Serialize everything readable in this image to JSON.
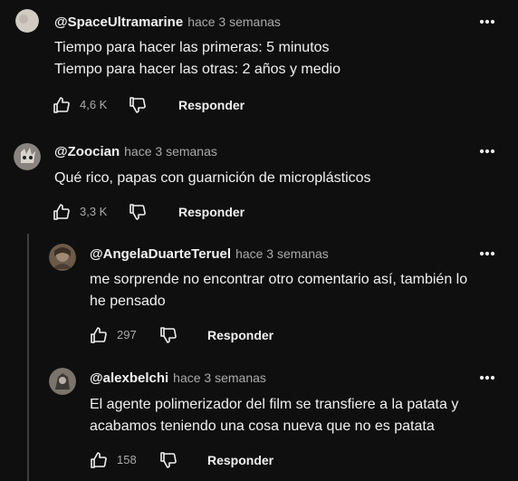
{
  "comments": [
    {
      "author": "@SpaceUltramarine",
      "timestamp": "hace 3 semanas",
      "lines": [
        "Tiempo para hacer las primeras: 5 minutos",
        "Tiempo para hacer las otras: 2 años y medio"
      ],
      "likes": "4,6 K",
      "reply_label": "Responder",
      "avatar_color": "#d0cbc3"
    },
    {
      "author": "@Zoocian",
      "timestamp": "hace 3 semanas",
      "lines": [
        "Qué rico, papas con guarnición de microplásticos"
      ],
      "likes": "3,3 K",
      "reply_label": "Responder",
      "avatar_color": "#8a8480"
    }
  ],
  "replies": [
    {
      "author": "@AngelaDuarteTeruel",
      "timestamp": "hace 3 semanas",
      "lines": [
        "me sorprende no encontrar otro comentario así, también lo",
        "he pensado"
      ],
      "likes": "297",
      "reply_label": "Responder",
      "avatar_color": "#6b5a48"
    },
    {
      "author": "@alexbelchi",
      "timestamp": "hace 3 semanas",
      "lines": [
        "El agente polimerizador del film se transfiere a la patata y",
        "acabamos teniendo una cosa nueva que no es patata"
      ],
      "likes": "158",
      "reply_label": "Responder",
      "avatar_color": "#7a746c"
    }
  ],
  "icons": {
    "like": "thumbs-up-icon",
    "dislike": "thumbs-down-icon",
    "more": "more-vertical-icon"
  },
  "colors": {
    "background": "#0f0f0f",
    "text": "#f1f1f1",
    "secondary_text": "#aaaaaa",
    "thread_line": "#3f3f3f"
  }
}
